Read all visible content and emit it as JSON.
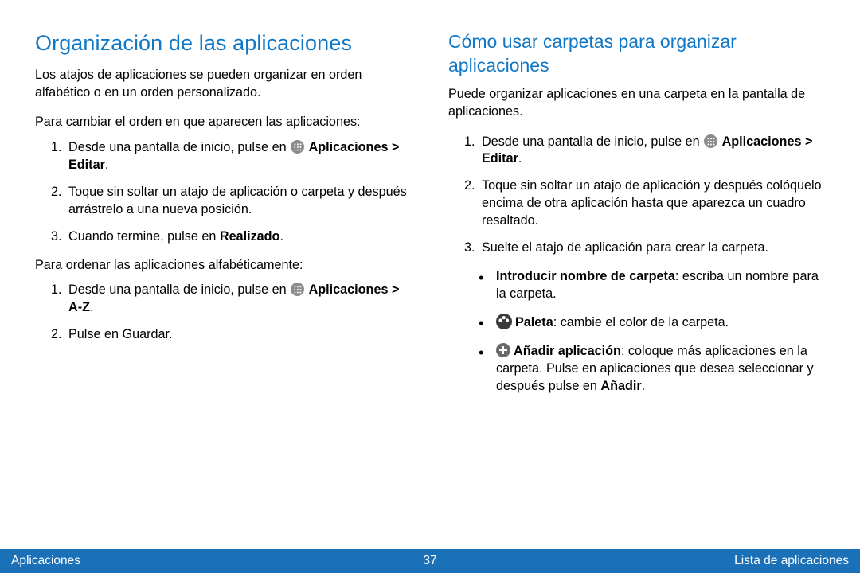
{
  "left": {
    "title": "Organización de las aplicaciones",
    "intro": "Los atajos de aplicaciones se pueden organizar en orden alfabético o en un orden personalizado.",
    "lead1": "Para cambiar el orden en que aparecen las aplicaciones:",
    "ol1": {
      "i1a": "Desde una pantalla de inicio, pulse en ",
      "i1b": "Aplicaciones > Editar",
      "i1c": ".",
      "i2": "Toque sin soltar un atajo de aplicación o carpeta y después arrástrelo a una nueva posición.",
      "i3a": "Cuando termine, pulse en ",
      "i3b": "Realizado",
      "i3c": "."
    },
    "lead2": "Para ordenar las aplicaciones alfabéticamente:",
    "ol2": {
      "i1a": "Desde una pantalla de inicio, pulse en ",
      "i1b": "Aplicaciones > A-Z",
      "i1c": ".",
      "i2": "Pulse en Guardar."
    }
  },
  "right": {
    "title": "Cómo usar carpetas para organizar aplicaciones",
    "intro": "Puede organizar aplicaciones en una carpeta en la pantalla de aplicaciones.",
    "ol": {
      "i1a": "Desde una pantalla de inicio, pulse en ",
      "i1b": "Aplicaciones > Editar",
      "i1c": ".",
      "i2": "Toque sin soltar un atajo de aplicación y después colóquelo encima de otra aplicación hasta que aparezca un cuadro resaltado.",
      "i3": "Suelte el atajo de aplicación para crear la carpeta."
    },
    "bullets": {
      "b1a": "Introducir nombre de carpeta",
      "b1b": ": escriba un nombre para la carpeta.",
      "b2a": "Paleta",
      "b2b": ": cambie el color de la carpeta.",
      "b3a": "Añadir aplicación",
      "b3b": ": coloque más aplicaciones en la carpeta. Pulse en aplicaciones que desea seleccionar y después pulse en ",
      "b3c": "Añadir",
      "b3d": "."
    }
  },
  "footer": {
    "left": "Aplicaciones",
    "page": "37",
    "right": "Lista de aplicaciones"
  }
}
